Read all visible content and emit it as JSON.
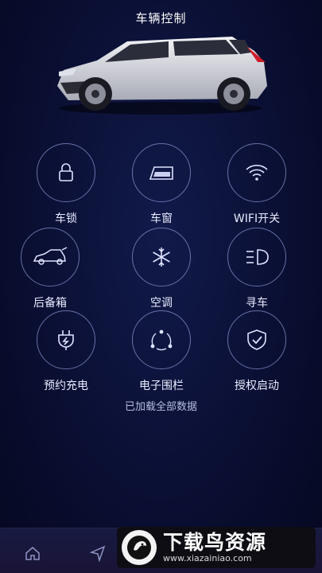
{
  "header": {
    "title": "车辆控制"
  },
  "controls": [
    {
      "label": "车锁",
      "icon": "lock-icon"
    },
    {
      "label": "车窗",
      "icon": "window-icon"
    },
    {
      "label": "WIFI开关",
      "icon": "wifi-icon"
    },
    {
      "label": "后备箱",
      "icon": "trunk-icon"
    },
    {
      "label": "空调",
      "icon": "snowflake-icon"
    },
    {
      "label": "寻车",
      "icon": "headlight-icon"
    },
    {
      "label": "预约充电",
      "icon": "charging-plug-icon"
    },
    {
      "label": "电子围栏",
      "icon": "geofence-icon"
    },
    {
      "label": "授权启动",
      "icon": "shield-check-icon"
    }
  ],
  "status_text": "已加载全部数据",
  "bottom_nav": [
    {
      "icon": "home-icon"
    },
    {
      "icon": "navigation-icon"
    }
  ],
  "watermark": {
    "name": "下载鸟资源",
    "url": "www.xiazainiao.com"
  },
  "colors": {
    "background": "#0a0f33",
    "ring": "#b4beff",
    "text": "#e9ecff"
  }
}
